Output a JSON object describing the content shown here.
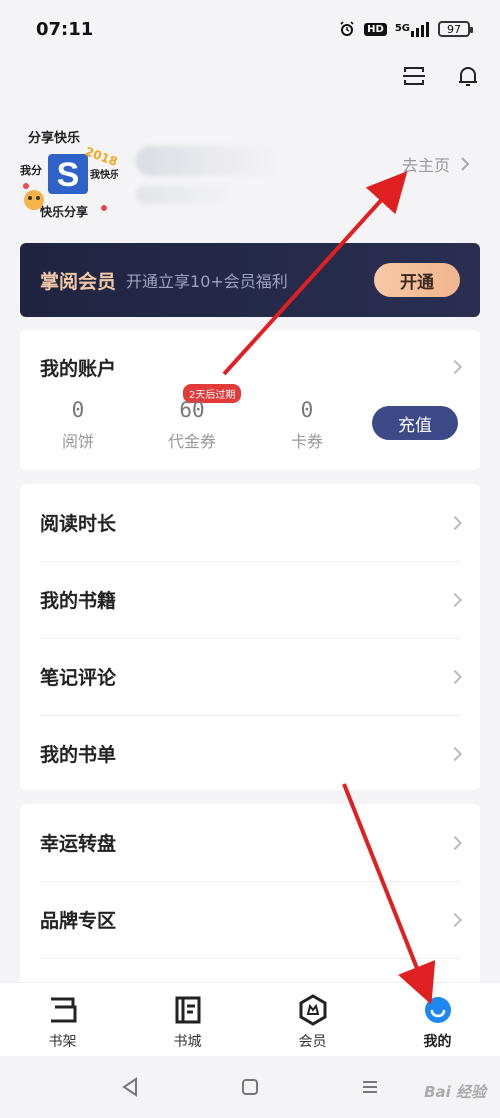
{
  "status_bar": {
    "time": "07:11",
    "battery": "97",
    "network": "5G"
  },
  "top_icons": [
    "scan-icon",
    "bell-icon"
  ],
  "profile": {
    "avatar_text_1": "分享快乐",
    "avatar_text_2": "2018",
    "avatar_text_3": "我分",
    "avatar_text_4": "我快乐",
    "avatar_text_5": "快乐分享",
    "avatar_logo": "S",
    "home_link": "去主页"
  },
  "vip": {
    "title": "掌阅会员",
    "desc": "开通立享10+会员福利",
    "button": "开通"
  },
  "account": {
    "title": "我的账户",
    "stats": [
      {
        "value": "0",
        "label": "阅饼"
      },
      {
        "value": "60",
        "label": "代金券"
      },
      {
        "value": "0",
        "label": "卡券"
      }
    ],
    "badge": "2天后过期",
    "recharge": "充值"
  },
  "menu1": [
    {
      "label": "阅读时长"
    },
    {
      "label": "我的书籍"
    },
    {
      "label": "笔记评论"
    },
    {
      "label": "我的书单"
    }
  ],
  "menu2": [
    {
      "label": "幸运转盘"
    },
    {
      "label": "品牌专区"
    }
  ],
  "tabs": [
    {
      "label": "书架",
      "icon": "bookshelf-icon"
    },
    {
      "label": "书城",
      "icon": "bookstore-icon"
    },
    {
      "label": "会员",
      "icon": "vip-icon"
    },
    {
      "label": "我的",
      "icon": "me-icon",
      "active": true
    }
  ],
  "colors": {
    "accent_blue": "#1e88f0",
    "vip_bg": "#1f2440",
    "recharge_btn": "#3c4a87",
    "arrow_red": "#e02020",
    "badge_red": "#e23b3b"
  },
  "watermark": "Bai  经验"
}
